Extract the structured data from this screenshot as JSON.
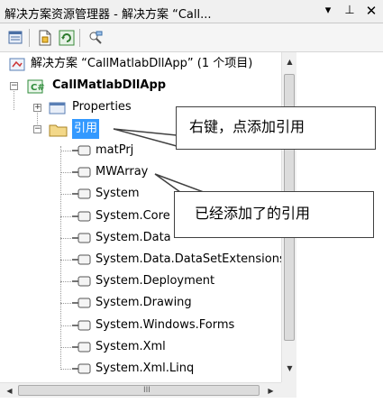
{
  "title_bar": {
    "title": "解决方案资源管理器 - 解决方案 “Call...",
    "dropdown_glyph": "▾",
    "pin_glyph": "⊥",
    "close_glyph": "✕"
  },
  "tree": {
    "solution": {
      "label": "解决方案 “CallMatlabDllApp” (1 个项目)"
    },
    "project": {
      "label": "CallMatlabDllApp",
      "expanded_glyph": "−"
    },
    "properties": {
      "label": "Properties",
      "collapsed_glyph": "+"
    },
    "references": {
      "label": "引用",
      "expanded_glyph": "−"
    },
    "reference_items": [
      "matPrj",
      "MWArray",
      "System",
      "System.Core",
      "System.Data",
      "System.Data.DataSetExtensions",
      "System.Deployment",
      "System.Drawing",
      "System.Windows.Forms",
      "System.Xml",
      "System.Xml.Linq"
    ]
  },
  "callouts": {
    "add_reference": "右键，点添加引用",
    "added_references": "已经添加了的引用"
  },
  "scrollbars": {
    "up_glyph": "▲",
    "down_glyph": "▼",
    "left_glyph": "◀",
    "right_glyph": "▶",
    "grip_glyph": "III"
  },
  "colors": {
    "selection": "#3399ff",
    "project_icon": "#2e8b3a",
    "folder_icon": "#d9b24a"
  }
}
